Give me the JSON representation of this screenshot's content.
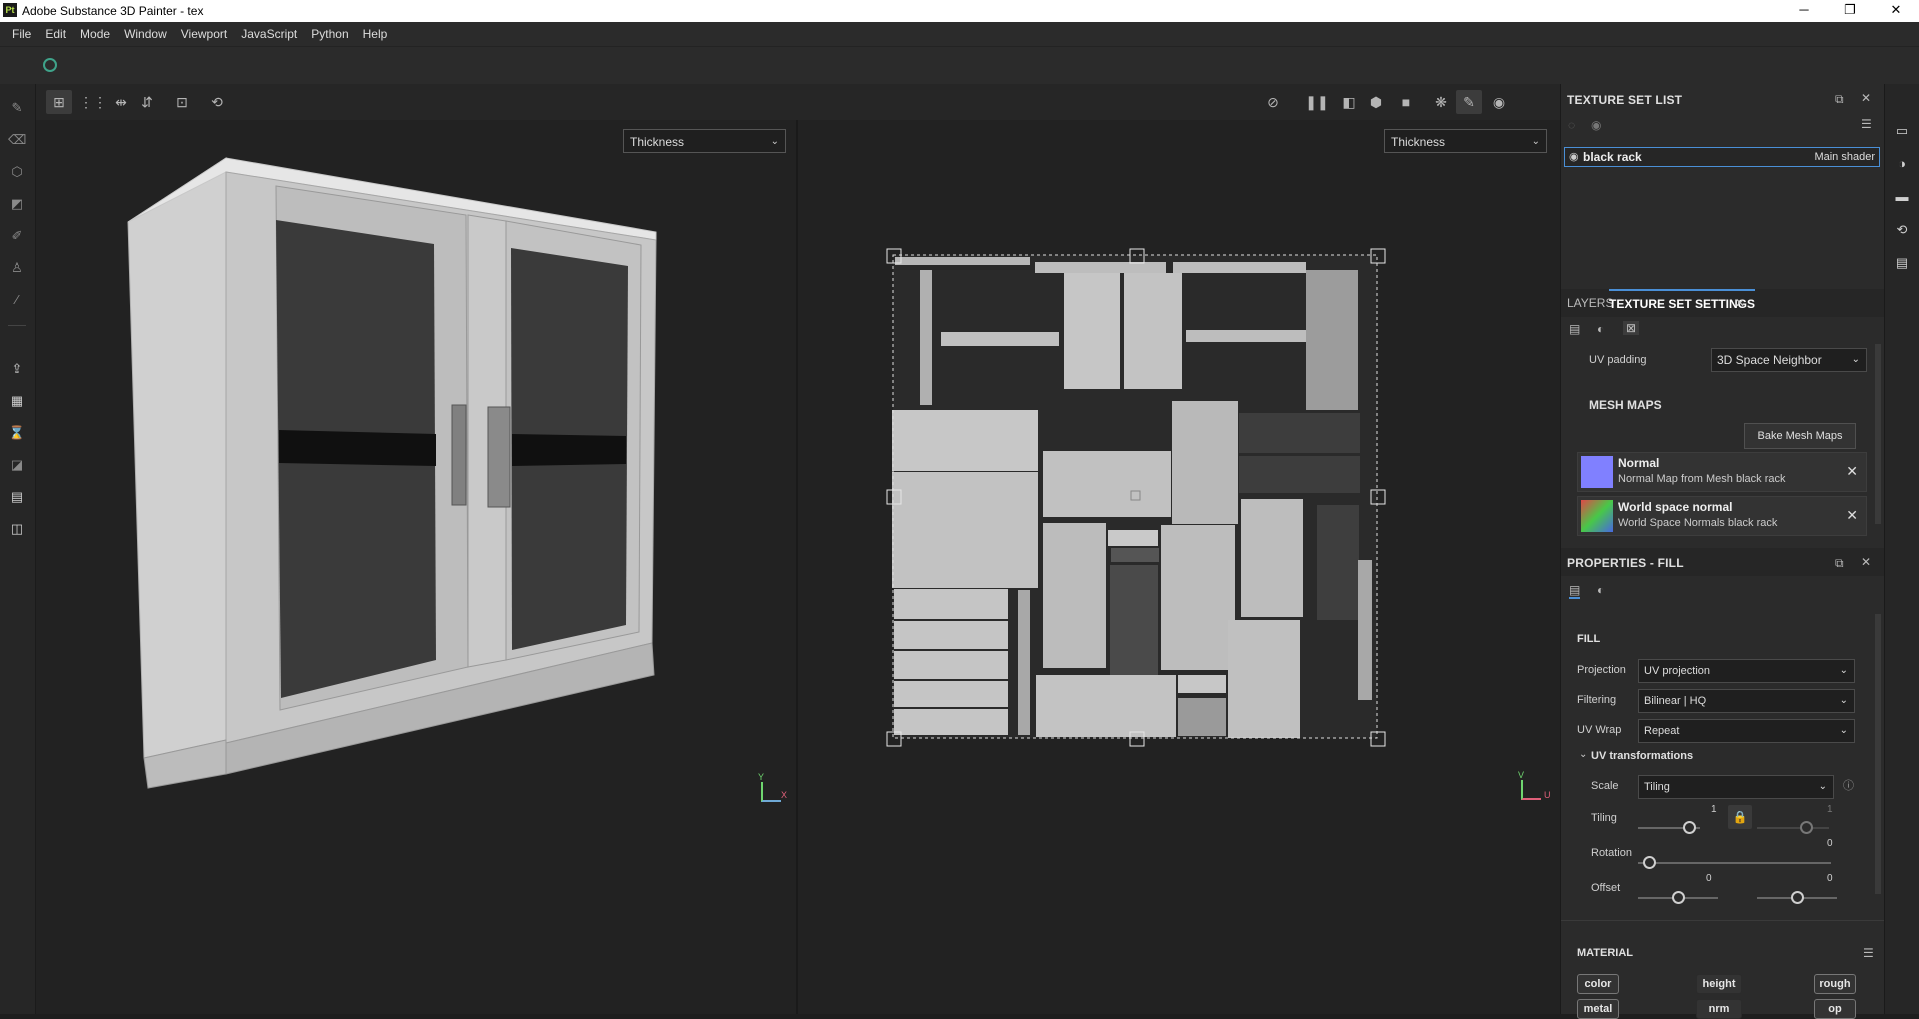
{
  "window": {
    "app_icon_text": "Pt",
    "title": "Adobe Substance 3D Painter - tex",
    "minimize": "─",
    "maximize": "❐",
    "close": "✕"
  },
  "menubar": {
    "items": [
      "File",
      "Edit",
      "Mode",
      "Window",
      "Viewport",
      "JavaScript",
      "Python",
      "Help"
    ]
  },
  "viewport": {
    "left_channel": "Thickness",
    "right_channel": "Thickness",
    "axis_left": {
      "y": "Y",
      "x": "X"
    },
    "axis_right": {
      "v": "V",
      "u": "U"
    }
  },
  "texture_set_list": {
    "title": "TEXTURE SET LIST",
    "item_name": "black rack",
    "item_shader": "Main shader"
  },
  "texture_set_settings": {
    "tab_layers": "LAYERS",
    "tab_settings": "TEXTURE SET SETTINGS",
    "uv_padding_label": "UV padding",
    "uv_padding_value": "3D Space Neighbor",
    "mesh_maps_header": "MESH MAPS",
    "bake_button": "Bake Mesh Maps",
    "mesh_maps": [
      {
        "name": "Normal",
        "desc": "Normal Map from Mesh black rack"
      },
      {
        "name": "World space normal",
        "desc": "World Space Normals black rack"
      }
    ]
  },
  "properties": {
    "title": "PROPERTIES - FILL",
    "fill_header": "FILL",
    "projection_label": "Projection",
    "projection_value": "UV projection",
    "filtering_label": "Filtering",
    "filtering_value": "Bilinear | HQ",
    "uvwrap_label": "UV Wrap",
    "uvwrap_value": "Repeat",
    "uv_transform_header": "UV transformations",
    "scale_label": "Scale",
    "scale_value": "Tiling",
    "tiling_label": "Tiling",
    "tiling_value_1": "1",
    "tiling_value_2": "1",
    "rotation_label": "Rotation",
    "rotation_value": "0",
    "offset_label": "Offset",
    "offset_value_1": "0",
    "offset_value_2": "0",
    "material_header": "MATERIAL",
    "channels_row1": [
      "color",
      "height",
      "rough"
    ],
    "channels_row2": [
      "metal",
      "nrm",
      "op"
    ]
  }
}
